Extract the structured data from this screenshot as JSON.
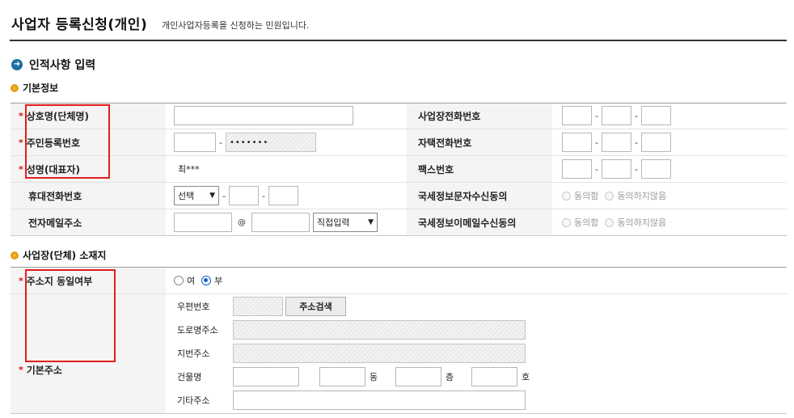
{
  "header": {
    "title": "사업자 등록신청(개인)",
    "description": "개인사업자등록을 신청하는 민원입니다."
  },
  "section": {
    "icon": "arrow-right-circle-icon",
    "title": "인적사항 입력"
  },
  "basic": {
    "icon": "bullet-circle-icon",
    "title": "기본정보",
    "left": [
      {
        "label": "상호명(단체명)",
        "required": true
      },
      {
        "label": "주민등록번호",
        "required": true,
        "masked": "•••••••"
      },
      {
        "label": "성명(대표자)",
        "required": true,
        "value": "최***"
      },
      {
        "label": "휴대전화번호",
        "required": false,
        "select": "선택"
      },
      {
        "label": "전자메일주소",
        "required": false,
        "at": "@",
        "select": "직접입력"
      }
    ],
    "right": [
      {
        "label": "사업장전화번호"
      },
      {
        "label": "자택전화번호"
      },
      {
        "label": "팩스번호"
      },
      {
        "label": "국세정보문자수신동의",
        "yes": "동의함",
        "no": "동의하지않음"
      },
      {
        "label": "국세정보이메일수신동의",
        "yes": "동의함",
        "no": "동의하지않음"
      }
    ],
    "dash": "-"
  },
  "location": {
    "icon": "bullet-circle-icon",
    "title": "사업장(단체) 소재지",
    "same_label": "주소지 동일여부",
    "opt_yes": "여",
    "opt_no": "부",
    "selected": "부",
    "addr_label": "기본주소",
    "postcode": "우편번호",
    "search_button": "주소검색",
    "road": "도로명주소",
    "jibun": "지번주소",
    "building": "건물명",
    "dong": "동",
    "floor": "층",
    "ho": "호",
    "etc": "기타주소"
  }
}
